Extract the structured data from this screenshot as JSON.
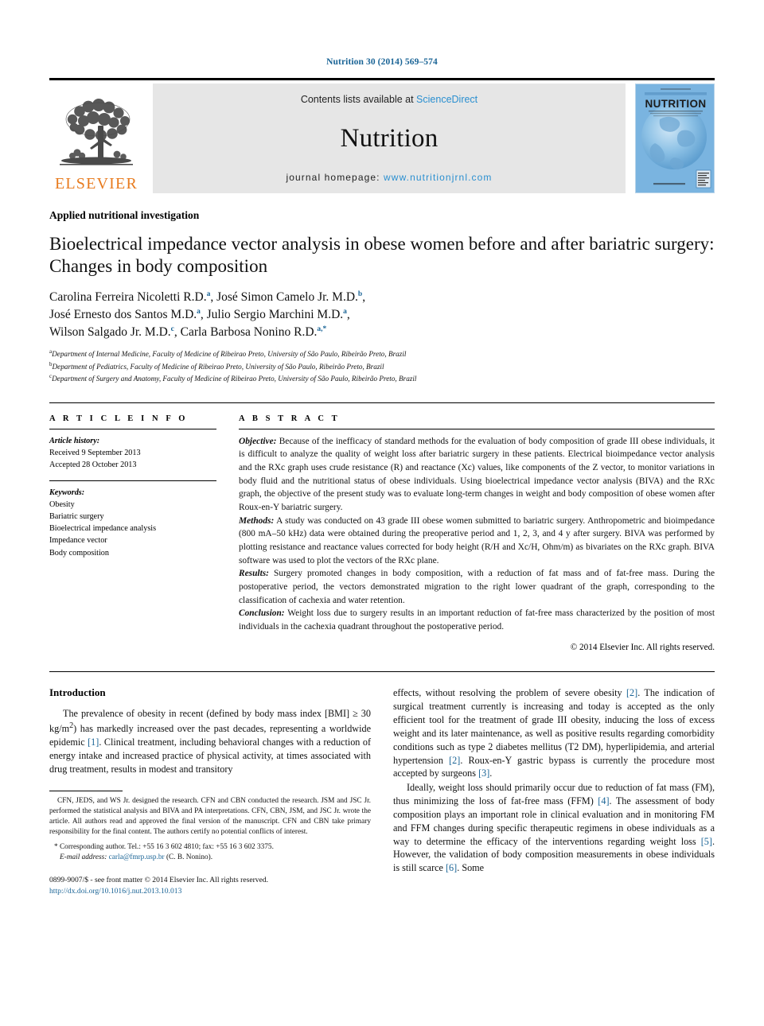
{
  "running_head": "Nutrition 30 (2014) 569–574",
  "masthead": {
    "contents_prefix": "Contents lists available at ",
    "sciencedirect": "ScienceDirect",
    "journal_name": "Nutrition",
    "homepage_prefix": "journal homepage: ",
    "homepage_url": "www.nutritionjrnl.com",
    "publisher": "ELSEVIER",
    "cover_title": "NUTRITION",
    "cover_subtitle": "The International Journal of Applied and Basic Nutritional Sciences",
    "cover_topline": "Volume 30",
    "cover_footer": "ISSN 0899-9007"
  },
  "colors": {
    "link": "#1a6496",
    "sciencedirect": "#2a8fd0",
    "elsevier_orange": "#e87b1e",
    "band_gray": "#e6e6e6",
    "cover_blue": "#7ab4e0"
  },
  "section_kind": "Applied nutritional investigation",
  "title": "Bioelectrical impedance vector analysis in obese women before and after bariatric surgery: Changes in body composition",
  "authors": [
    {
      "name": "Carolina Ferreira Nicoletti R.D.",
      "marks": "a",
      "sep": ", "
    },
    {
      "name": "José Simon Camelo Jr. M.D.",
      "marks": "b",
      "sep": ","
    },
    {
      "name": "José Ernesto dos Santos M.D.",
      "marks": "a",
      "sep": ", "
    },
    {
      "name": "Julio Sergio Marchini M.D.",
      "marks": "a",
      "sep": ","
    },
    {
      "name": "Wilson Salgado Jr. M.D.",
      "marks": "c",
      "sep": ", "
    },
    {
      "name": "Carla Barbosa Nonino R.D.",
      "marks": "a,*",
      "sep": ""
    }
  ],
  "affiliations": [
    {
      "mark": "a",
      "text": "Department of Internal Medicine, Faculty of Medicine of Ribeirao Preto, University of São Paulo, Ribeirão Preto, Brazil"
    },
    {
      "mark": "b",
      "text": "Department of Pediatrics, Faculty of Medicine of Ribeirao Preto, University of São Paulo, Ribeirão Preto, Brazil"
    },
    {
      "mark": "c",
      "text": "Department of Surgery and Anatomy, Faculty of Medicine of Ribeirao Preto, University of São Paulo, Ribeirão Preto, Brazil"
    }
  ],
  "article_info": {
    "heading": "A R T I C L E   I N F O",
    "history_label": "Article history:",
    "history": [
      "Received 9 September 2013",
      "Accepted 28 October 2013"
    ],
    "keywords_label": "Keywords:",
    "keywords": [
      "Obesity",
      "Bariatric surgery",
      "Bioelectrical impedance analysis",
      "Impedance vector",
      "Body composition"
    ]
  },
  "abstract": {
    "heading": "A B S T R A C T",
    "objective_label": "Objective:",
    "objective": " Because of the inefficacy of standard methods for the evaluation of body composition of grade III obese individuals, it is difficult to analyze the quality of weight loss after bariatric surgery in these patients. Electrical bioimpedance vector analysis and the RXc graph uses crude resistance (R) and reactance (Xc) values, like components of the Z vector, to monitor variations in body fluid and the nutritional status of obese individuals. Using bioelectrical impedance vector analysis (BIVA) and the RXc graph, the objective of the present study was to evaluate long-term changes in weight and body composition of obese women after Roux-en-Y bariatric surgery.",
    "methods_label": "Methods:",
    "methods": " A study was conducted on 43 grade III obese women submitted to bariatric surgery. Anthropometric and bioimpedance (800 mA–50 kHz) data were obtained during the preoperative period and 1, 2, 3, and 4 y after surgery. BIVA was performed by plotting resistance and reactance values corrected for body height (R/H and Xc/H, Ohm/m) as bivariates on the RXc graph. BIVA software was used to plot the vectors of the RXc plane.",
    "results_label": "Results:",
    "results": " Surgery promoted changes in body composition, with a reduction of fat mass and of fat-free mass. During the postoperative period, the vectors demonstrated migration to the right lower quadrant of the graph, corresponding to the classification of cachexia and water retention.",
    "conclusion_label": "Conclusion:",
    "conclusion": " Weight loss due to surgery results in an important reduction of fat-free mass characterized by the position of most individuals in the cachexia quadrant throughout the postoperative period.",
    "copyright": "© 2014 Elsevier Inc. All rights reserved."
  },
  "introduction": {
    "heading": "Introduction",
    "p1_a": "The prevalence of obesity in recent (defined by body mass index [BMI] ≥ 30 kg/m",
    "p1_sup": "2",
    "p1_b": ") has markedly increased over the past decades, representing a worldwide epidemic ",
    "p1_ref1": "[1]",
    "p1_c": ". Clinical treatment, including behavioral changes with a reduction of energy intake and increased practice of physical activity, at times associated with drug treatment, results in modest and transitory",
    "p2_a": "effects, without resolving the problem of severe obesity ",
    "p2_ref2": "[2]",
    "p2_b": ". The indication of surgical treatment currently is increasing and today is accepted as the only efficient tool for the treatment of grade III obesity, inducing the loss of excess weight and its later maintenance, as well as positive results regarding comorbidity conditions such as type 2 diabetes mellitus (T2 DM), hyperlipidemia, and arterial hypertension ",
    "p2_ref2b": "[2]",
    "p2_c": ". Roux-en-Y gastric bypass is currently the procedure most accepted by surgeons ",
    "p2_ref3": "[3]",
    "p2_d": ".",
    "p3_a": "Ideally, weight loss should primarily occur due to reduction of fat mass (FM), thus minimizing the loss of fat-free mass (FFM) ",
    "p3_ref4": "[4]",
    "p3_b": ". The assessment of body composition plays an important role in clinical evaluation and in monitoring FM and FFM changes during specific therapeutic regimens in obese individuals as a way to determine the efficacy of the interventions regarding weight loss ",
    "p3_ref5": "[5]",
    "p3_c": ". However, the validation of body composition measurements in obese individuals is still scarce ",
    "p3_ref6": "[6]",
    "p3_d": ". Some"
  },
  "footnotes": {
    "contributions": "CFN, JEDS, and WS Jr. designed the research. CFN and CBN conducted the research. JSM and JSC Jr. performed the statistical analysis and BIVA and PA interpretations. CFN, CBN, JSM, and JSC Jr. wrote the article. All authors read and approved the final version of the manuscript. CFN and CBN take primary responsibility for the final content. The authors certify no potential conflicts of interest.",
    "corresponding_marker": "*",
    "corresponding": " Corresponding author. Tel.: +55 16 3 602 4810; fax: +55 16 3 602 3375.",
    "email_label": "E-mail address:",
    "email": "carla@fmrp.usp.br",
    "email_owner": " (C. B. Nonino).",
    "issn_line": "0899-9007/$ - see front matter © 2014 Elsevier Inc. All rights reserved.",
    "doi": "http://dx.doi.org/10.1016/j.nut.2013.10.013"
  }
}
